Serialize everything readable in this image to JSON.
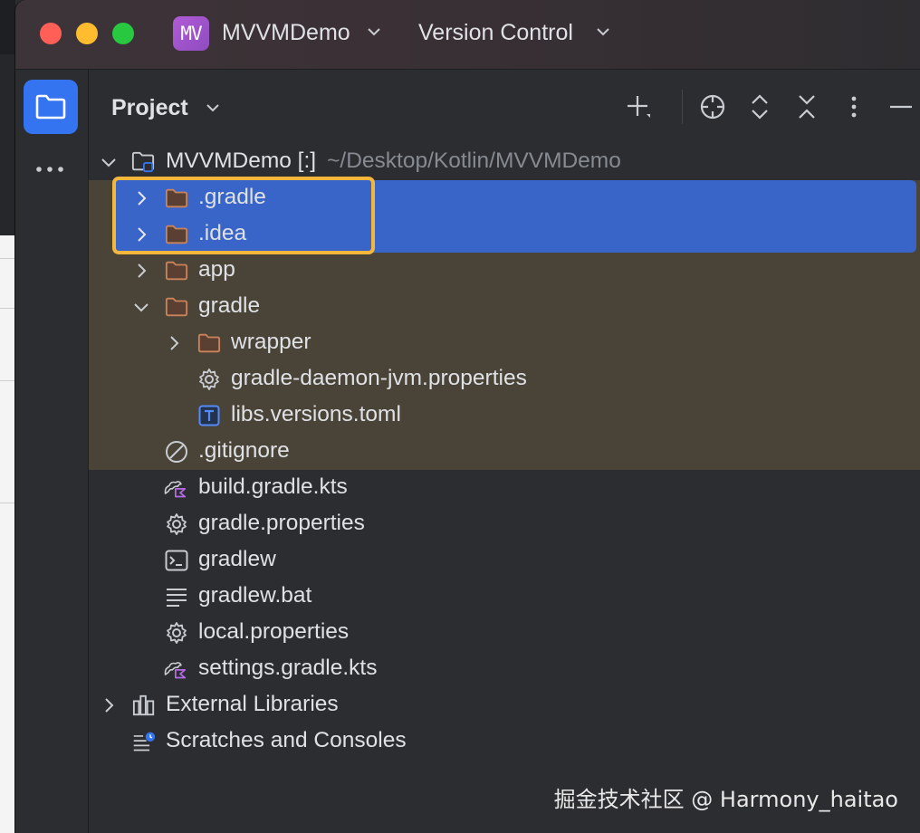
{
  "titlebar": {
    "project_badge": "MV",
    "project_name": "MVVMDemo",
    "vcs_label": "Version Control"
  },
  "panel": {
    "title": "Project",
    "toolbar_icons": [
      "add-icon",
      "locate-icon",
      "expand-all-icon",
      "collapse-all-icon",
      "more-options-icon",
      "hide-icon"
    ]
  },
  "tree": {
    "root": {
      "name": "MVVMDemo",
      "module_tag": "[:]",
      "path": "~/Desktop/Kotlin/MVVMDemo"
    },
    "items": [
      {
        "label": ".gradle",
        "icon": "folder-icon",
        "expandable": true,
        "expanded": false
      },
      {
        "label": ".idea",
        "icon": "folder-icon",
        "expandable": true,
        "expanded": false
      },
      {
        "label": "app",
        "icon": "folder-icon",
        "expandable": true,
        "expanded": false
      },
      {
        "label": "gradle",
        "icon": "folder-icon",
        "expandable": true,
        "expanded": true
      },
      {
        "label": "wrapper",
        "icon": "folder-icon",
        "expandable": true,
        "expanded": false
      },
      {
        "label": "gradle-daemon-jvm.properties",
        "icon": "gear-icon"
      },
      {
        "label": "libs.versions.toml",
        "icon": "toml-file-icon"
      },
      {
        "label": ".gitignore",
        "icon": "ignore-icon"
      },
      {
        "label": "build.gradle.kts",
        "icon": "gradle-kts-icon"
      },
      {
        "label": "gradle.properties",
        "icon": "gear-icon"
      },
      {
        "label": "gradlew",
        "icon": "terminal-icon"
      },
      {
        "label": "gradlew.bat",
        "icon": "text-file-icon"
      },
      {
        "label": "local.properties",
        "icon": "gear-icon"
      },
      {
        "label": "settings.gradle.kts",
        "icon": "gradle-kts-icon"
      },
      {
        "label": "External Libraries",
        "icon": "library-icon",
        "expandable": true,
        "expanded": false
      },
      {
        "label": "Scratches and Consoles",
        "icon": "scratches-icon"
      }
    ]
  },
  "colors": {
    "selection": "#3865c7",
    "highlight_border": "#f4b73c",
    "excluded_background": "#4a4438",
    "folder": "#c9835a",
    "accent": "#3574f0"
  },
  "watermark": "掘金技术社区 @ Harmony_haitao"
}
